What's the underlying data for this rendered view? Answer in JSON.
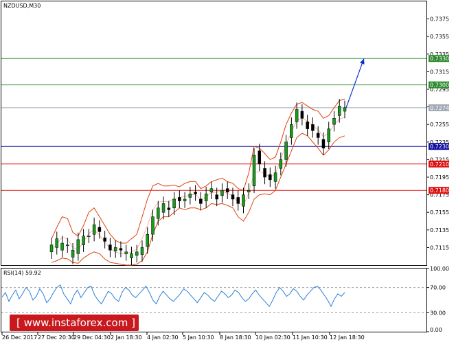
{
  "chart_data": [
    {
      "type": "candlestick",
      "title": "NZDUSD,M30",
      "ylim": [
        0.7095,
        0.7395
      ],
      "y_ticks": [
        "0.7375",
        "0.7355",
        "0.7335",
        "0.7315",
        "0.7295",
        "0.7275",
        "0.7255",
        "0.7235",
        "0.7215",
        "0.7195",
        "0.7175",
        "0.7155",
        "0.7135",
        "0.7115"
      ],
      "x_ticks": [
        "26 Dec 2017",
        "27 Dec 20:30",
        "29 Dec 04:30",
        "2 Jan 18:30",
        "4 Jan 02:30",
        "5 Jan 10:30",
        "8 Jan 18:30",
        "10 Jan 02:30",
        "11 Jan 10:30",
        "12 Jan 18:30"
      ],
      "levels": [
        {
          "value": 0.733,
          "label": "0.7330",
          "color": "#2e8b2e"
        },
        {
          "value": 0.73,
          "label": "0.7300",
          "color": "#2e8b2e"
        },
        {
          "value": 0.7274,
          "label": "0.7274",
          "color": "#a0a8b4"
        },
        {
          "value": 0.723,
          "label": "0.7230",
          "color": "#1010a0"
        },
        {
          "value": 0.721,
          "label": "0.7210",
          "color": "#e01010"
        },
        {
          "value": 0.718,
          "label": "0.7180",
          "color": "#e01010"
        }
      ],
      "price_path": [
        [
          0.711,
          0.7118
        ],
        [
          0.7115,
          0.7125
        ],
        [
          0.7112,
          0.712
        ],
        [
          0.7117,
          0.7118
        ],
        [
          0.7104,
          0.7112
        ],
        [
          0.7108,
          0.7124
        ],
        [
          0.7118,
          0.7128
        ],
        [
          0.7128,
          0.7128
        ],
        [
          0.713,
          0.7141
        ],
        [
          0.7138,
          0.7133
        ],
        [
          0.7126,
          0.7122
        ],
        [
          0.7118,
          0.7112
        ],
        [
          0.7111,
          0.7115
        ],
        [
          0.7114,
          0.7112
        ],
        [
          0.7108,
          0.711
        ],
        [
          0.7103,
          0.7108
        ],
        [
          0.7106,
          0.711
        ],
        [
          0.7107,
          0.7115
        ],
        [
          0.7116,
          0.713
        ],
        [
          0.713,
          0.715
        ],
        [
          0.7148,
          0.716
        ],
        [
          0.7155,
          0.7165
        ],
        [
          0.716,
          0.7158
        ],
        [
          0.716,
          0.717
        ],
        [
          0.7172,
          0.7168
        ],
        [
          0.7168,
          0.717
        ],
        [
          0.7172,
          0.7176
        ],
        [
          0.7178,
          0.7176
        ],
        [
          0.717,
          0.7165
        ],
        [
          0.7168,
          0.7176
        ],
        [
          0.7178,
          0.7182
        ],
        [
          0.7175,
          0.717
        ],
        [
          0.7174,
          0.718
        ],
        [
          0.7182,
          0.7178
        ],
        [
          0.7175,
          0.717
        ],
        [
          0.7172,
          0.7165
        ],
        [
          0.7162,
          0.7175
        ],
        [
          0.7178,
          0.718
        ],
        [
          0.7185,
          0.722
        ],
        [
          0.7225,
          0.721
        ],
        [
          0.7205,
          0.7195
        ],
        [
          0.7198,
          0.7192
        ],
        [
          0.719,
          0.72
        ],
        [
          0.7205,
          0.7215
        ],
        [
          0.7215,
          0.7235
        ],
        [
          0.724,
          0.7255
        ],
        [
          0.7258,
          0.7272
        ],
        [
          0.727,
          0.7262
        ],
        [
          0.7258,
          0.725
        ],
        [
          0.7255,
          0.7248
        ],
        [
          0.7245,
          0.724
        ],
        [
          0.7238,
          0.7228
        ],
        [
          0.7235,
          0.725
        ],
        [
          0.7255,
          0.7262
        ],
        [
          0.7265,
          0.7276
        ],
        [
          0.727,
          0.7274
        ]
      ],
      "bollinger_upper": [
        0.7125,
        0.7138,
        0.715,
        0.7148,
        0.7132,
        0.7128,
        0.714,
        0.7155,
        0.716,
        0.715,
        0.714,
        0.713,
        0.7123,
        0.712,
        0.712,
        0.7125,
        0.713,
        0.715,
        0.717,
        0.7185,
        0.7188,
        0.7185,
        0.7185,
        0.7186,
        0.7184,
        0.7188,
        0.719,
        0.719,
        0.7182,
        0.7185,
        0.719,
        0.7192,
        0.7194,
        0.719,
        0.7188,
        0.7182,
        0.718,
        0.72,
        0.723,
        0.7228,
        0.7222,
        0.7215,
        0.7218,
        0.7235,
        0.7255,
        0.7268,
        0.7278,
        0.728,
        0.7276,
        0.7272,
        0.727,
        0.7262,
        0.7265,
        0.7274,
        0.7282,
        0.7284
      ],
      "bollinger_lower": [
        0.7098,
        0.71,
        0.7103,
        0.7102,
        0.7098,
        0.7097,
        0.7103,
        0.7107,
        0.711,
        0.7108,
        0.7102,
        0.7098,
        0.7097,
        0.7096,
        0.7095,
        0.7095,
        0.7096,
        0.71,
        0.711,
        0.713,
        0.7145,
        0.715,
        0.715,
        0.7155,
        0.716,
        0.7158,
        0.716,
        0.716,
        0.7158,
        0.716,
        0.7165,
        0.7164,
        0.7165,
        0.7163,
        0.716,
        0.715,
        0.7145,
        0.7155,
        0.717,
        0.7175,
        0.7176,
        0.7175,
        0.718,
        0.7195,
        0.721,
        0.7225,
        0.724,
        0.7245,
        0.7242,
        0.7235,
        0.7228,
        0.722,
        0.7226,
        0.7235,
        0.724,
        0.7242
      ],
      "arrow": {
        "from": [
          0.7274,
          0.7274
        ],
        "to": [
          0.733,
          0.733
        ]
      }
    },
    {
      "type": "line",
      "title": "RSI(14) 59.92",
      "ylim": [
        0,
        100
      ],
      "y_ticks": [
        "100.00",
        "70.00",
        "30.00",
        "0.00"
      ],
      "levels": [
        70,
        30
      ],
      "series": [
        {
          "values": [
            55,
            62,
            48,
            58,
            66,
            52,
            60,
            70,
            64,
            50,
            56,
            68,
            60,
            46,
            52,
            62,
            70,
            74,
            60,
            52,
            44,
            58,
            66,
            54,
            62,
            70,
            72,
            58,
            50,
            44,
            54,
            64,
            60,
            52,
            48,
            62,
            70,
            66,
            58,
            54,
            60,
            66,
            72,
            62,
            50,
            44,
            56,
            64,
            58,
            52,
            48,
            54,
            60,
            68,
            64,
            58,
            52,
            46,
            54,
            62,
            58,
            52,
            48,
            56,
            64,
            60,
            54,
            58,
            66,
            62,
            54,
            48,
            52,
            60,
            66,
            58,
            52,
            46,
            40,
            50,
            62,
            70,
            64,
            56,
            60,
            68,
            64,
            56,
            50,
            58,
            64,
            70,
            72,
            66,
            58,
            50,
            40,
            52,
            60,
            56,
            62
          ]
        }
      ]
    }
  ],
  "watermark": "www.instaforex.com"
}
